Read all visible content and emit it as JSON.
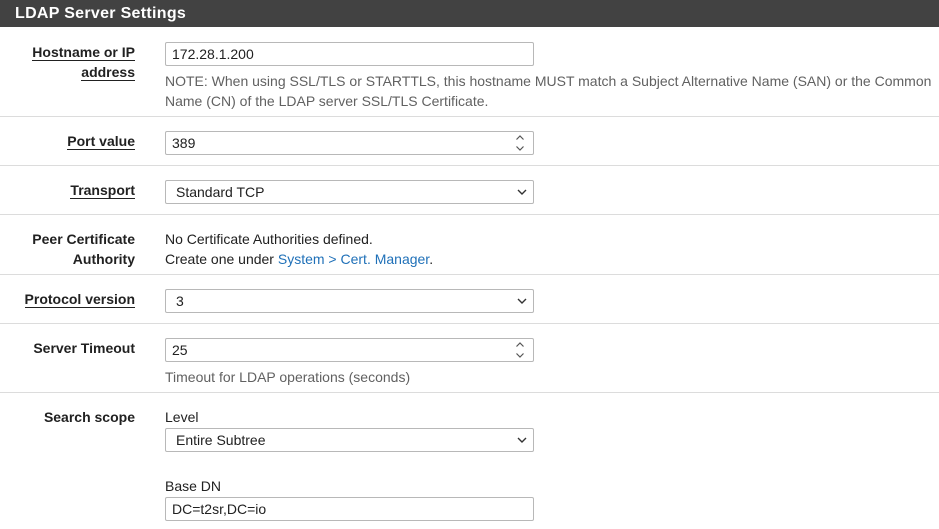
{
  "panel": {
    "title": "LDAP Server Settings"
  },
  "hostname": {
    "label_line1": "Hostname or IP",
    "label_line2": "address",
    "value": "172.28.1.200",
    "note_line1": "NOTE: When using SSL/TLS or STARTTLS, this hostname MUST match a Subject Alternative Name (SAN) or the Common",
    "note_line2": "Name (CN) of the LDAP server SSL/TLS Certificate."
  },
  "port": {
    "label": "Port value",
    "value": "389"
  },
  "transport": {
    "label": "Transport",
    "selected": "Standard TCP"
  },
  "peer_ca": {
    "label_line1": "Peer Certificate",
    "label_line2": "Authority",
    "text_line1": "No Certificate Authorities defined.",
    "text_prefix": "Create one under ",
    "link_text": "System > Cert. Manager",
    "text_suffix": "."
  },
  "protocol": {
    "label": "Protocol version",
    "selected": "3"
  },
  "timeout": {
    "label": "Server Timeout",
    "value": "25",
    "help": "Timeout for LDAP operations (seconds)"
  },
  "search_scope": {
    "label": "Search scope",
    "level_label": "Level",
    "level_selected": "Entire Subtree",
    "base_dn_label": "Base DN",
    "base_dn_value": "DC=t2sr,DC=io"
  }
}
